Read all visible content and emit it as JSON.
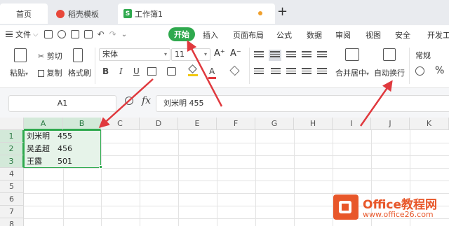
{
  "tabs": {
    "home": "首页",
    "template": "稻壳模板",
    "workbook": "工作簿1",
    "workbook_badge": "S",
    "new_tab": "+"
  },
  "menu": {
    "file": "文件",
    "file_arrow": "⌵",
    "more_arrow": "⌄",
    "start": "开始",
    "insert": "插入",
    "page_layout": "页面布局",
    "formula": "公式",
    "data": "数据",
    "review": "审阅",
    "view": "视图",
    "security": "安全",
    "dev": "开发工"
  },
  "ribbon": {
    "cut": "剪切",
    "paste": "粘贴",
    "paste_arrow": "▾",
    "copy": "复制",
    "format_painter": "格式刷",
    "font_name": "宋体",
    "font_size": "11",
    "grow_font": "A⁺",
    "shrink_font": "A⁻",
    "bold": "B",
    "italic": "I",
    "underline": "U",
    "font_color_letter": "A",
    "merge_center": "合并居中",
    "merge_arrow": "▾",
    "wrap_text": "自动换行",
    "number_format": "常规",
    "percent": "%"
  },
  "formula_bar": {
    "name_box": "A1",
    "fx": "fx",
    "content": "刘米明  455"
  },
  "sheet": {
    "columns": [
      "A",
      "B",
      "C",
      "D",
      "E",
      "F",
      "G",
      "H",
      "I",
      "J",
      "K"
    ],
    "rows": [
      "1",
      "2",
      "3",
      "4",
      "5",
      "6",
      "7",
      "8"
    ],
    "cells": [
      {
        "name": "刘米明",
        "value": "455"
      },
      {
        "name": "吴孟超",
        "value": "456"
      },
      {
        "name": "王露",
        "value": "501"
      }
    ]
  },
  "watermark": {
    "title": "Office教程网",
    "url": "www.office26.com"
  },
  "colors": {
    "accent_green": "#2fa94e",
    "arrow_red": "#e0393e",
    "watermark_orange": "#e8572a"
  }
}
